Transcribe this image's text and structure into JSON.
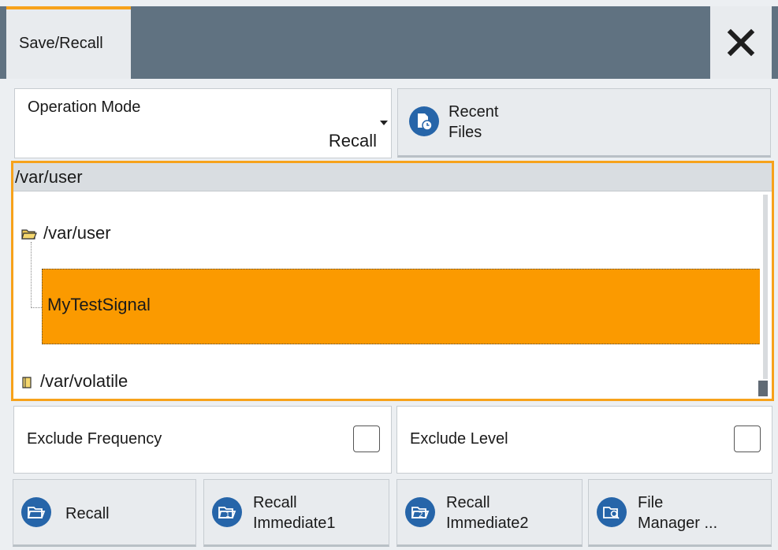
{
  "dialog": {
    "tab_label": "Save/Recall",
    "close_icon": "close-icon"
  },
  "operation_mode": {
    "label": "Operation Mode",
    "value": "Recall"
  },
  "recent_files": {
    "label_line1": "Recent",
    "label_line2": "Files",
    "icon": "recent-files-icon"
  },
  "file_tree": {
    "header_path": "/var/user",
    "items": [
      {
        "label": "/var/user",
        "icon": "folder-open-icon"
      },
      {
        "label": "MyTestSignal",
        "selected": true
      },
      {
        "label": "/var/volatile",
        "icon": "folder-icon"
      }
    ]
  },
  "exclude_frequency": {
    "label": "Exclude Frequency",
    "checked": false
  },
  "exclude_level": {
    "label": "Exclude Level",
    "checked": false
  },
  "buttons": {
    "recall": {
      "label": "Recall",
      "icon": "folder-open-icon"
    },
    "recall_immediate1": {
      "line1": "Recall",
      "line2": "Immediate1",
      "icon": "recall-immediate-1-icon"
    },
    "recall_immediate2": {
      "line1": "Recall",
      "line2": "Immediate2",
      "icon": "recall-immediate-2-icon"
    },
    "file_manager": {
      "line1": "File",
      "line2": "Manager ...",
      "icon": "file-manager-icon"
    }
  },
  "colors": {
    "accent": "#f7a21b",
    "selection": "#fb9a00",
    "titlebar": "#607281",
    "icon_blue": "#2665a9"
  }
}
